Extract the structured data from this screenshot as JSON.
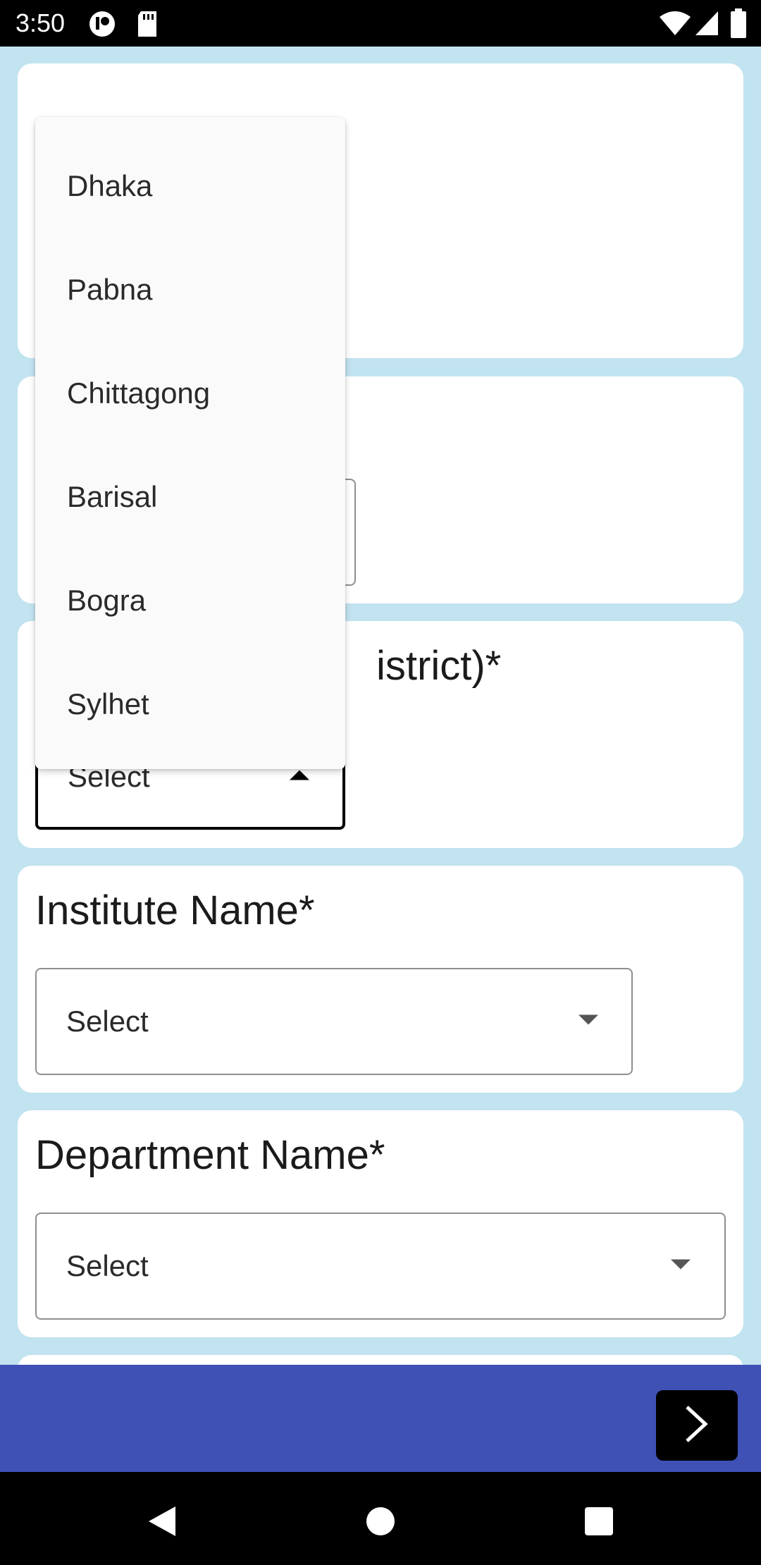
{
  "status_bar": {
    "time": "3:50",
    "left_icons": [
      "pocket-icon",
      "sd-card-icon"
    ],
    "right_icons": [
      "wifi-icon",
      "signal-icon",
      "battery-icon"
    ]
  },
  "form": {
    "district": {
      "label_visible_fragment": "istrict)*",
      "select_value": "Select",
      "expanded": true,
      "options": [
        "Dhaka",
        "Pabna",
        "Chittagong",
        "Barisal",
        "Bogra",
        "Sylhet"
      ]
    },
    "institute": {
      "label": "Institute Name*",
      "select_value": "Select"
    },
    "department": {
      "label": "Department Name*",
      "select_value": "Select"
    }
  },
  "colors": {
    "page_background": "#c2e3f0",
    "bottom_bar": "#3f51b5",
    "next_button": "#000000"
  },
  "bottom_bar": {
    "next_icon": "chevron-right-icon"
  },
  "nav_bar": {
    "icons": [
      "back-icon",
      "home-icon",
      "recents-icon"
    ]
  }
}
